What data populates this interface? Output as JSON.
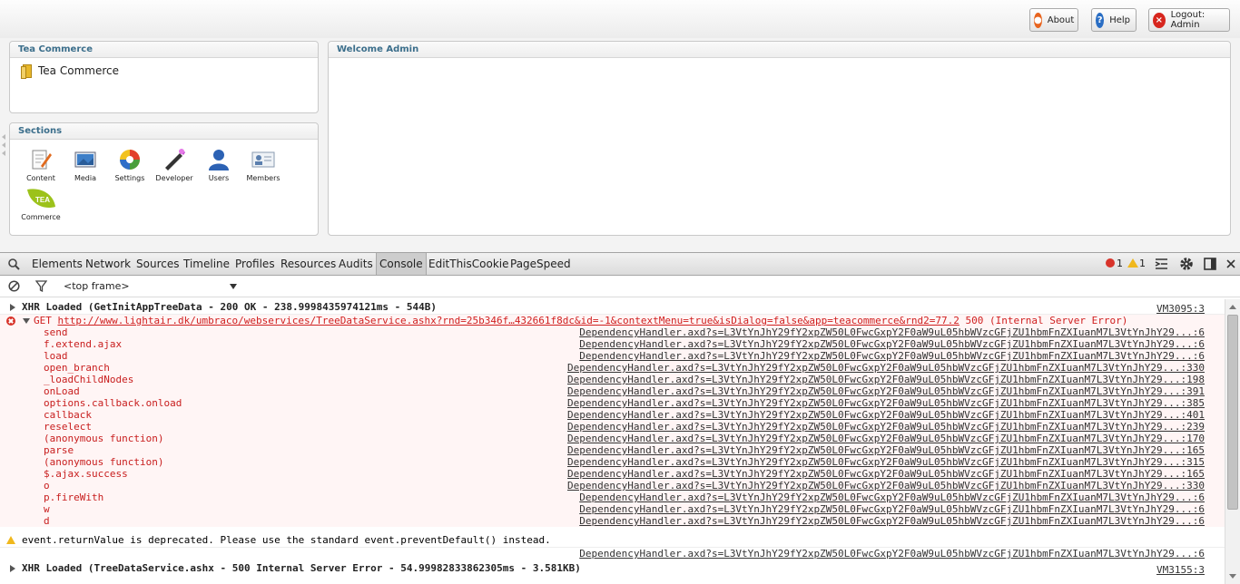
{
  "topbar": {
    "about_label": "About",
    "help_label": "Help",
    "logout_label": "Logout: Admin"
  },
  "tree_panel": {
    "title": "Tea Commerce",
    "node_label": "Tea Commerce"
  },
  "sections_panel": {
    "title": "Sections",
    "items": [
      {
        "label": "Content",
        "icon": "content-icon"
      },
      {
        "label": "Media",
        "icon": "media-icon"
      },
      {
        "label": "Settings",
        "icon": "settings-icon"
      },
      {
        "label": "Developer",
        "icon": "developer-icon"
      },
      {
        "label": "Users",
        "icon": "users-icon"
      },
      {
        "label": "Members",
        "icon": "members-icon"
      },
      {
        "label": "Commerce",
        "icon": "tea-commerce-icon",
        "icon_text": "TEA"
      }
    ]
  },
  "welcome_panel": {
    "title": "Welcome Admin"
  },
  "devtools": {
    "tabs": [
      "Elements",
      "Network",
      "Sources",
      "Timeline",
      "Profiles",
      "Resources",
      "Audits",
      "Console",
      "EditThisCookie",
      "PageSpeed"
    ],
    "active_tab": "Console",
    "error_count": "1",
    "warning_count": "1",
    "frame_select": "<top frame>",
    "colors": {
      "error": "#d02020",
      "warning": "#f0b81d"
    }
  },
  "console": {
    "xhr1": {
      "text": "XHR Loaded (GetInitAppTreeData - 200 OK - 238.9998435974121ms - 544B)",
      "source": "VM3095:3"
    },
    "error": {
      "method": "GET",
      "url": "http://www.lightair.dk/umbraco/webservices/TreeDataService.ashx?rnd=25b346f…432661f8dc&id=-1&contextMenu=true&isDialog=false&app=teacommerce&rnd2=77.2",
      "status": "500 (Internal Server Error)"
    },
    "stack": [
      {
        "fn": "send",
        "src": "DependencyHandler.axd?s=L3VtYnJhY29fY2xpZW50L0FwcGxpY2F0aW9uL05hbWVzcGFjZU1hbmFnZXIuanM7L3VtYnJhY29...:6"
      },
      {
        "fn": "f.extend.ajax",
        "src": "DependencyHandler.axd?s=L3VtYnJhY29fY2xpZW50L0FwcGxpY2F0aW9uL05hbWVzcGFjZU1hbmFnZXIuanM7L3VtYnJhY29...:6"
      },
      {
        "fn": "load",
        "src": "DependencyHandler.axd?s=L3VtYnJhY29fY2xpZW50L0FwcGxpY2F0aW9uL05hbWVzcGFjZU1hbmFnZXIuanM7L3VtYnJhY29...:6"
      },
      {
        "fn": "open_branch",
        "src": "DependencyHandler.axd?s=L3VtYnJhY29fY2xpZW50L0FwcGxpY2F0aW9uL05hbWVzcGFjZU1hbmFnZXIuanM7L3VtYnJhY29...:330"
      },
      {
        "fn": "_loadChildNodes",
        "src": "DependencyHandler.axd?s=L3VtYnJhY29fY2xpZW50L0FwcGxpY2F0aW9uL05hbWVzcGFjZU1hbmFnZXIuanM7L3VtYnJhY29...:198"
      },
      {
        "fn": "onLoad",
        "src": "DependencyHandler.axd?s=L3VtYnJhY29fY2xpZW50L0FwcGxpY2F0aW9uL05hbWVzcGFjZU1hbmFnZXIuanM7L3VtYnJhY29...:391"
      },
      {
        "fn": "options.callback.onload",
        "src": "DependencyHandler.axd?s=L3VtYnJhY29fY2xpZW50L0FwcGxpY2F0aW9uL05hbWVzcGFjZU1hbmFnZXIuanM7L3VtYnJhY29...:385"
      },
      {
        "fn": "callback",
        "src": "DependencyHandler.axd?s=L3VtYnJhY29fY2xpZW50L0FwcGxpY2F0aW9uL05hbWVzcGFjZU1hbmFnZXIuanM7L3VtYnJhY29...:401"
      },
      {
        "fn": "reselect",
        "src": "DependencyHandler.axd?s=L3VtYnJhY29fY2xpZW50L0FwcGxpY2F0aW9uL05hbWVzcGFjZU1hbmFnZXIuanM7L3VtYnJhY29...:239"
      },
      {
        "fn": "(anonymous function)",
        "src": "DependencyHandler.axd?s=L3VtYnJhY29fY2xpZW50L0FwcGxpY2F0aW9uL05hbWVzcGFjZU1hbmFnZXIuanM7L3VtYnJhY29...:170"
      },
      {
        "fn": "parse",
        "src": "DependencyHandler.axd?s=L3VtYnJhY29fY2xpZW50L0FwcGxpY2F0aW9uL05hbWVzcGFjZU1hbmFnZXIuanM7L3VtYnJhY29...:165"
      },
      {
        "fn": "(anonymous function)",
        "src": "DependencyHandler.axd?s=L3VtYnJhY29fY2xpZW50L0FwcGxpY2F0aW9uL05hbWVzcGFjZU1hbmFnZXIuanM7L3VtYnJhY29...:315"
      },
      {
        "fn": "$.ajax.success",
        "src": "DependencyHandler.axd?s=L3VtYnJhY29fY2xpZW50L0FwcGxpY2F0aW9uL05hbWVzcGFjZU1hbmFnZXIuanM7L3VtYnJhY29...:165"
      },
      {
        "fn": "o",
        "src": "DependencyHandler.axd?s=L3VtYnJhY29fY2xpZW50L0FwcGxpY2F0aW9uL05hbWVzcGFjZU1hbmFnZXIuanM7L3VtYnJhY29...:330"
      },
      {
        "fn": "p.fireWith",
        "src": "DependencyHandler.axd?s=L3VtYnJhY29fY2xpZW50L0FwcGxpY2F0aW9uL05hbWVzcGFjZU1hbmFnZXIuanM7L3VtYnJhY29...:6"
      },
      {
        "fn": "w",
        "src": "DependencyHandler.axd?s=L3VtYnJhY29fY2xpZW50L0FwcGxpY2F0aW9uL05hbWVzcGFjZU1hbmFnZXIuanM7L3VtYnJhY29...:6"
      },
      {
        "fn": "d",
        "src": "DependencyHandler.axd?s=L3VtYnJhY29fY2xpZW50L0FwcGxpY2F0aW9uL05hbWVzcGFjZU1hbmFnZXIuanM7L3VtYnJhY29...:6"
      }
    ],
    "warning": {
      "text": "event.returnValue is deprecated. Please use the standard event.preventDefault() instead.",
      "source": "DependencyHandler.axd?s=L3VtYnJhY29fY2xpZW50L0FwcGxpY2F0aW9uL05hbWVzcGFjZU1hbmFnZXIuanM7L3VtYnJhY29...:6"
    },
    "xhr2": {
      "text": "XHR Loaded (TreeDataService.ashx - 500 Internal Server Error - 54.99982833862305ms - 3.581KB)",
      "source": "VM3155:3"
    }
  }
}
